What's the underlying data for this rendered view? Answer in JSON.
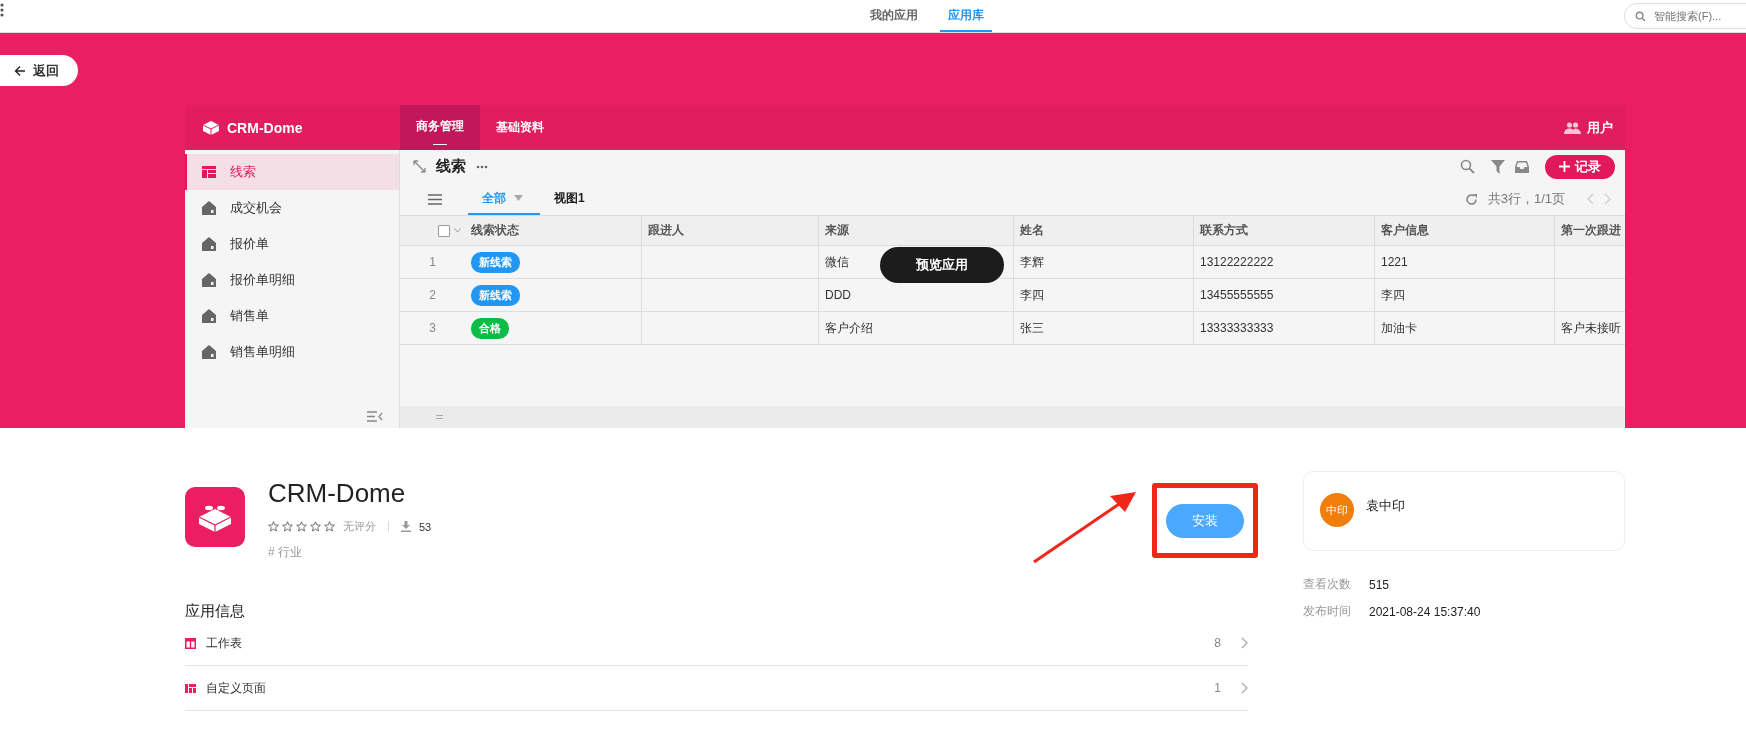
{
  "top_bar": {
    "tabs": [
      {
        "label": "我的应用",
        "selected": false
      },
      {
        "label": "应用库",
        "selected": true
      }
    ],
    "search": {
      "placeholder": "智能搜索(F)..."
    }
  },
  "back_button": "返回",
  "preview": {
    "app_name": "CRM-Dome",
    "tabs": [
      {
        "label": "商务管理",
        "selected": true
      },
      {
        "label": "基础资料",
        "selected": false
      }
    ],
    "user_label": "用户",
    "sidebar": [
      {
        "label": "线索",
        "selected": true,
        "kind": "table"
      },
      {
        "label": "成交机会",
        "selected": false,
        "kind": "house"
      },
      {
        "label": "报价单",
        "selected": false,
        "kind": "house"
      },
      {
        "label": "报价单明细",
        "selected": false,
        "kind": "house"
      },
      {
        "label": "销售单",
        "selected": false,
        "kind": "house"
      },
      {
        "label": "销售单明细",
        "selected": false,
        "kind": "house"
      }
    ],
    "title": "线索",
    "add_button": "记录",
    "views": [
      {
        "label": "全部",
        "selected": true
      },
      {
        "label": "视图1",
        "selected": false
      }
    ],
    "record_summary": "共3行，1/1页",
    "select_all": {
      "checked": false
    },
    "columns": [
      "线索状态",
      "跟进人",
      "来源",
      "姓名",
      "联系方式",
      "客户信息",
      "第一次跟进"
    ],
    "rows": [
      {
        "number": "1",
        "color": "#2196f3",
        "cells": [
          "新线索",
          "",
          "微信",
          "李辉",
          "13122222222",
          "1221",
          ""
        ]
      },
      {
        "number": "2",
        "color": "#2196f3",
        "cells": [
          "新线索",
          "",
          "DDD",
          "李四",
          "13455555555",
          "李四",
          ""
        ]
      },
      {
        "number": "3",
        "color": "#0bbd47",
        "cells": [
          "合格",
          "",
          "客户介绍",
          "张三",
          "13333333333",
          "加油卡",
          "客户未接听"
        ]
      }
    ],
    "overlay_button": "预览应用"
  },
  "app": {
    "name": "CRM-Dome",
    "stars": 0,
    "rating_text": "无评分",
    "downloads": "53",
    "tag": "# 行业",
    "install_button": "安装"
  },
  "info": {
    "title": "应用信息",
    "items": [
      {
        "label": "工作表",
        "count": "8",
        "kind": "worksheet"
      },
      {
        "label": "自定义页面",
        "count": "1",
        "kind": "page"
      }
    ]
  },
  "author": {
    "avatar": "中印",
    "name": "袁中印"
  },
  "stats": [
    {
      "label": "查看次数",
      "value": "515"
    },
    {
      "label": "发布时间",
      "value": "2021-08-24 15:37:40"
    }
  ]
}
